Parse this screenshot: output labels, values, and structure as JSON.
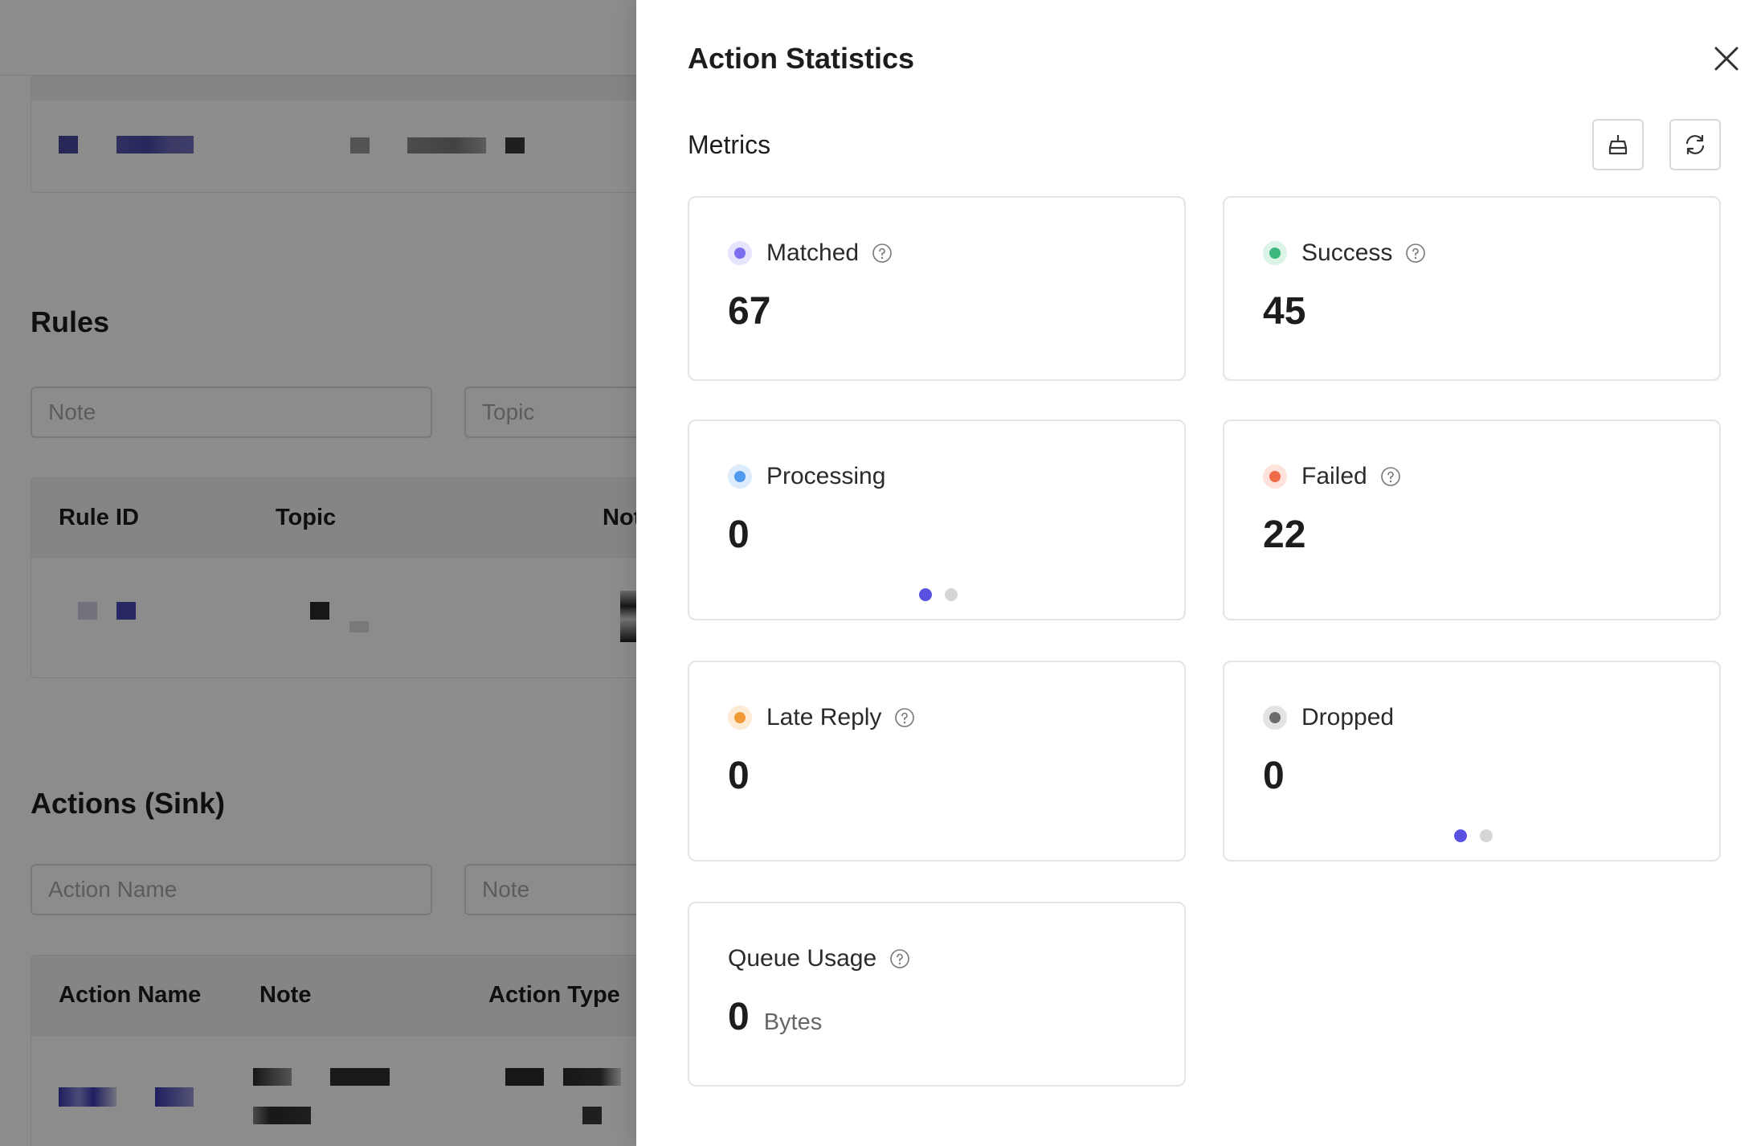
{
  "background": {
    "rules": {
      "heading": "Rules",
      "note_placeholder": "Note",
      "topic_placeholder": "Topic",
      "columns": [
        "Rule ID",
        "Topic",
        "Not"
      ]
    },
    "actions": {
      "heading": "Actions (Sink)",
      "action_name_placeholder": "Action Name",
      "note_placeholder": "Note",
      "columns": [
        "Action Name",
        "Note",
        "Action Type"
      ]
    }
  },
  "drawer": {
    "title": "Action Statistics",
    "section_title": "Metrics",
    "buttons": {
      "reset_icon": "broom-icon",
      "refresh_icon": "refresh-icon"
    },
    "metrics": [
      {
        "label": "Matched",
        "value": "67",
        "dot_color": "#7b6ff0",
        "dot_bg": "#e7e4fd",
        "help": true
      },
      {
        "label": "Success",
        "value": "45",
        "dot_color": "#3db87a",
        "dot_bg": "#dcf3e7",
        "help": true
      },
      {
        "label": "Processing",
        "value": "0",
        "dot_color": "#4f9bf0",
        "dot_bg": "#ddecfc",
        "help": false
      },
      {
        "label": "Failed",
        "value": "22",
        "dot_color": "#ef6b4a",
        "dot_bg": "#fde3dc",
        "help": true
      },
      {
        "label": "Late Reply",
        "value": "0",
        "dot_color": "#f09a38",
        "dot_bg": "#fdebd6",
        "help": true
      },
      {
        "label": "Dropped",
        "value": "0",
        "dot_color": "#6b6b6b",
        "dot_bg": "#e3e3e3",
        "help": false
      },
      {
        "label": "Queue Usage",
        "value": "0",
        "unit": "Bytes",
        "help": true
      }
    ],
    "pagers": {
      "active_color": "#5a50e0",
      "inactive_color": "#d6d6d6"
    }
  }
}
